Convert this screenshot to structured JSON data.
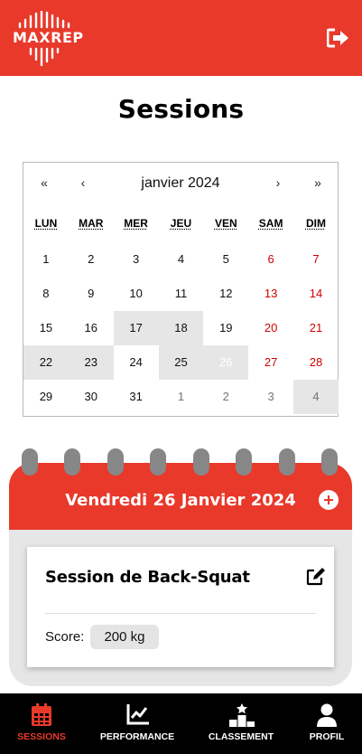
{
  "header": {
    "logo_text": "MAXREP",
    "logout_icon": "logout-icon",
    "colors": {
      "brand": "#e8392b",
      "white": "#ffffff"
    }
  },
  "page": {
    "title": "Sessions"
  },
  "calendar": {
    "prev_year": "«",
    "prev_month": "‹",
    "month_label": "janvier 2024",
    "next_month": "›",
    "next_year": "»",
    "weekdays": [
      "LUN",
      "MAR",
      "MER",
      "JEU",
      "VEN",
      "SAM",
      "DIM"
    ],
    "weeks": [
      [
        {
          "d": "1"
        },
        {
          "d": "2"
        },
        {
          "d": "3"
        },
        {
          "d": "4"
        },
        {
          "d": "5"
        },
        {
          "d": "6",
          "we": true
        },
        {
          "d": "7",
          "we": true
        }
      ],
      [
        {
          "d": "8"
        },
        {
          "d": "9"
        },
        {
          "d": "10"
        },
        {
          "d": "11"
        },
        {
          "d": "12"
        },
        {
          "d": "13",
          "we": true
        },
        {
          "d": "14",
          "we": true
        }
      ],
      [
        {
          "d": "15"
        },
        {
          "d": "16"
        },
        {
          "d": "17",
          "m": true
        },
        {
          "d": "18",
          "m": true
        },
        {
          "d": "19"
        },
        {
          "d": "20",
          "we": true
        },
        {
          "d": "21",
          "we": true
        }
      ],
      [
        {
          "d": "22",
          "m": true
        },
        {
          "d": "23",
          "m": true
        },
        {
          "d": "24"
        },
        {
          "d": "25",
          "m": true
        },
        {
          "d": "26",
          "sel": true
        },
        {
          "d": "27",
          "we": true
        },
        {
          "d": "28",
          "we": true
        }
      ],
      [
        {
          "d": "29"
        },
        {
          "d": "30"
        },
        {
          "d": "31"
        },
        {
          "d": "1",
          "o": true
        },
        {
          "d": "2",
          "o": true
        },
        {
          "d": "3",
          "o": true
        },
        {
          "d": "4",
          "o": true,
          "m": true
        }
      ]
    ],
    "colors": {
      "weekend": "#d10000",
      "marked": "#e6e6e6",
      "other_month": "#757575"
    }
  },
  "day_panel": {
    "title": "Vendredi 26 Janvier 2024",
    "add_icon": "plus-circle-icon"
  },
  "session": {
    "name": "Session de Back-Squat",
    "edit_icon": "edit-icon",
    "score_label": "Score:",
    "score_value": "200 kg"
  },
  "bottom_nav": {
    "items": [
      {
        "label": "SESSIONS",
        "icon": "calendar-icon",
        "active": true
      },
      {
        "label": "PERFORMANCE",
        "icon": "chart-line-icon",
        "active": false
      },
      {
        "label": "CLASSEMENT",
        "icon": "podium-icon",
        "active": false
      },
      {
        "label": "PROFIL",
        "icon": "user-icon",
        "active": false
      }
    ]
  }
}
